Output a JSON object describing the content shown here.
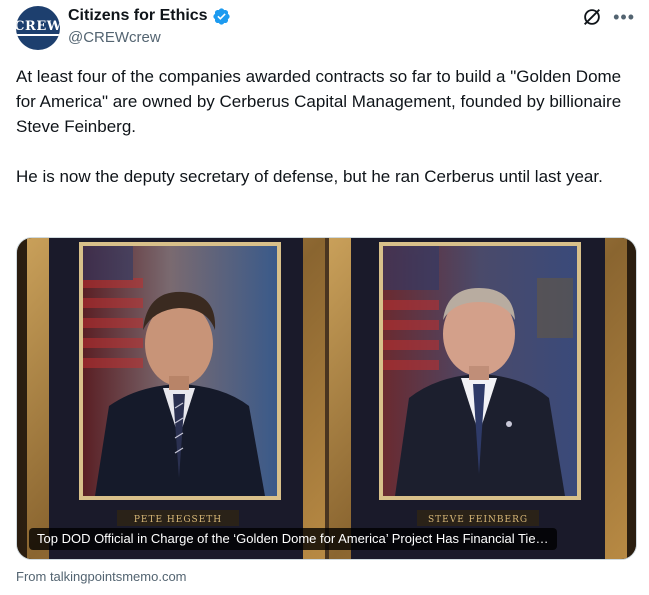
{
  "author": {
    "display_name": "Citizens for Ethics",
    "handle": "@CREWcrew",
    "avatar_text": "CREW",
    "verified_color": "#1d9bf0"
  },
  "tweet": {
    "paragraph_1": "At least four of the companies awarded contracts so far to build a \"Golden Dome for America\" are owned by Cerberus Capital Management, founded by billionaire Steve Feinberg.",
    "paragraph_2": "He is now the deputy secretary of defense, but he ran Cerberus until last year."
  },
  "card": {
    "caption": "Top DOD Official in Charge of the ‘Golden Dome for America’ Project Has Financial Tie…",
    "left_plaque": "PETE HEGSETH",
    "right_plaque": "STEVE FEINBERG",
    "source": "From talkingpointsmemo.com"
  },
  "icons": {
    "grok": "grok-icon",
    "more": "more-icon",
    "verified": "verified-badge-icon"
  },
  "colors": {
    "text": "#0f1419",
    "secondary": "#536471",
    "verified": "#1d9bf0"
  }
}
